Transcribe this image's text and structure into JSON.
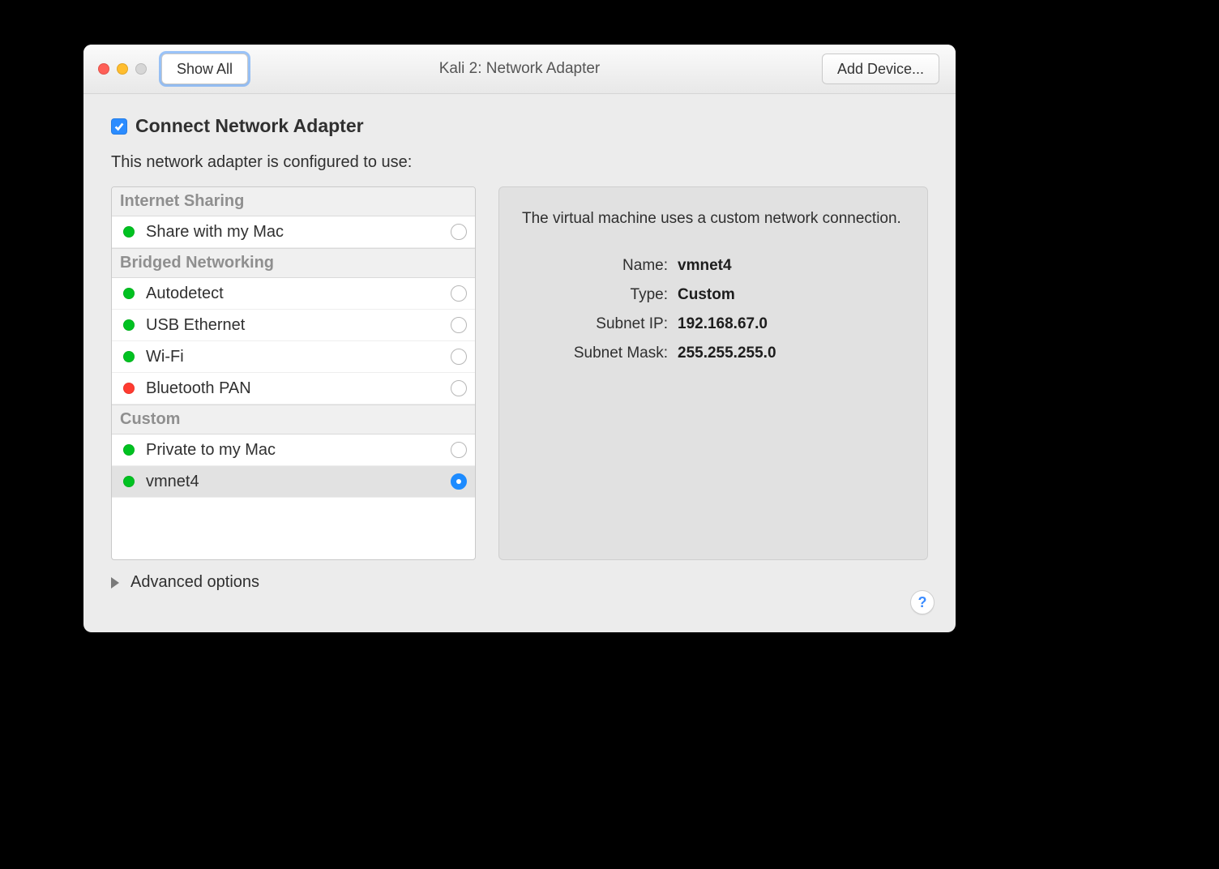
{
  "window": {
    "title": "Kali 2: Network Adapter",
    "show_all_label": "Show All",
    "add_device_label": "Add Device..."
  },
  "connect": {
    "checked": true,
    "label": "Connect Network Adapter"
  },
  "subtitle": "This network adapter is configured to use:",
  "groups": [
    {
      "header": "Internet Sharing",
      "rows": [
        {
          "status": "green",
          "label": "Share with my Mac",
          "selected": false
        }
      ]
    },
    {
      "header": "Bridged Networking",
      "rows": [
        {
          "status": "green",
          "label": "Autodetect",
          "selected": false
        },
        {
          "status": "green",
          "label": "USB Ethernet",
          "selected": false
        },
        {
          "status": "green",
          "label": "Wi-Fi",
          "selected": false
        },
        {
          "status": "red",
          "label": "Bluetooth PAN",
          "selected": false
        }
      ]
    },
    {
      "header": "Custom",
      "rows": [
        {
          "status": "green",
          "label": "Private to my Mac",
          "selected": false
        },
        {
          "status": "green",
          "label": "vmnet4",
          "selected": true
        }
      ]
    }
  ],
  "detail": {
    "description": "The virtual machine uses a custom network connection.",
    "name_label": "Name:",
    "name_value": "vmnet4",
    "type_label": "Type:",
    "type_value": "Custom",
    "subnet_ip_label": "Subnet IP:",
    "subnet_ip_value": "192.168.67.0",
    "subnet_mask_label": "Subnet Mask:",
    "subnet_mask_value": "255.255.255.0"
  },
  "advanced_label": "Advanced options",
  "help_label": "?"
}
